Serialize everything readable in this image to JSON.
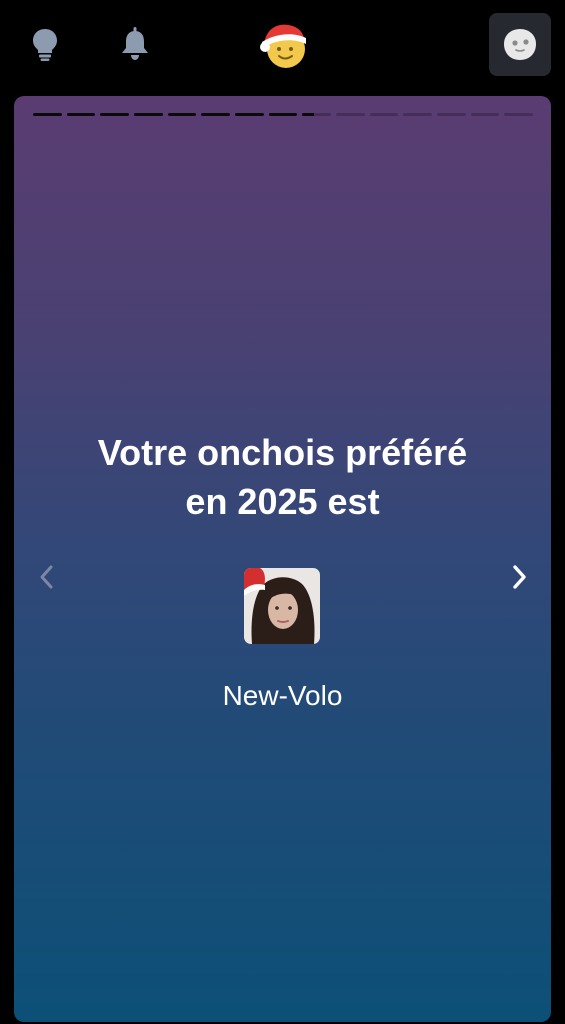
{
  "topbar": {
    "icons": [
      "lightbulb-icon",
      "bell-icon",
      "santa-smiley-logo",
      "profile-avatar-icon"
    ]
  },
  "story": {
    "progress": {
      "segments": 15,
      "completed": 8,
      "current_fraction": 0.4
    },
    "headline_line1": "Votre onchois préféré",
    "headline_line2": "en 2025 est",
    "username": "New-Volo",
    "prev_icon": "chevron-left-icon",
    "next_icon": "chevron-right-icon"
  },
  "colors": {
    "background": "#000000",
    "gradient_top": "#5a3c72",
    "gradient_bottom": "#0c5077",
    "icon_gray": "#8d9bb0",
    "text": "#ffffff"
  }
}
